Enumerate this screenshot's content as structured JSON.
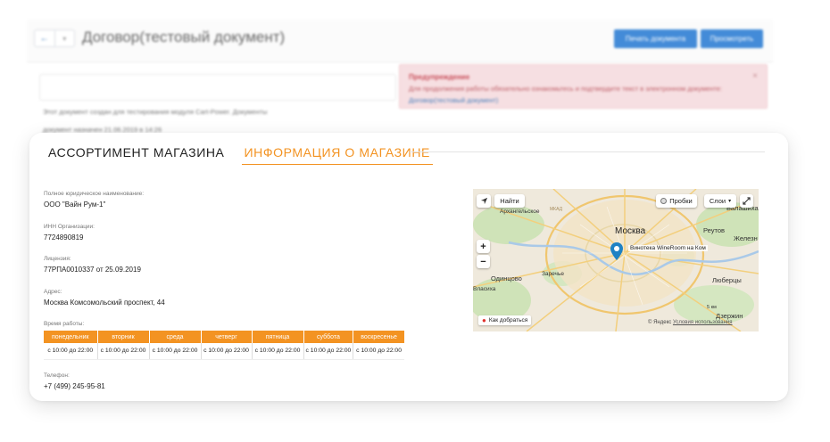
{
  "background": {
    "title": "Договор(тестовый документ)",
    "nav_back": "←",
    "nav_menu": "▾",
    "print_button": "Печать документа",
    "view_button": "Просмотреть",
    "warning": {
      "title": "Предупреждение",
      "text": "Для продолжения работы обязательно ознакомьтесь и подтвердите текст в электронном документе:",
      "link": "Договор(тестовый документ)",
      "close": "×"
    },
    "created_text": "Этот документ создан для тестирования модуля Cart-Power. Документы",
    "signed_text": "документ назначен 21.06.2019 в 14:26"
  },
  "tabs": {
    "assortment": "АССОРТИМЕНТ МАГАЗИНА",
    "info": "ИНФОРМАЦИЯ О МАГАЗИНЕ"
  },
  "store": {
    "legal_name_label": "Полное юридическое наименование:",
    "legal_name": "ООО \"Вайн Рум-1\"",
    "inn_label": "ИНН Организации:",
    "inn": "7724890819",
    "license_label": "Лицензия:",
    "license": "77РПА0010337 от 25.09.2019",
    "address_label": "Адрес:",
    "address": "Москва Комсомольский проспект, 44",
    "hours_label": "Время работы:",
    "days": [
      "понедельник",
      "вторник",
      "среда",
      "четверг",
      "пятница",
      "суббота",
      "воскресенье"
    ],
    "hours": [
      "с 10:00 до 22:00",
      "с 10:00 до 22:00",
      "с 10:00 до 22:00",
      "с 10:00 до 22:00",
      "с 10:00 до 22:00",
      "с 10:00 до 22:00",
      "с 10:00 до 22:00"
    ],
    "phone_label": "Телефон:",
    "phone": "+7 (499) 245-95-81"
  },
  "map": {
    "find_button": "Найти",
    "traffic_button": "Пробки",
    "layers_button": "Слои",
    "zoom_in": "+",
    "zoom_out": "−",
    "pin_label": "Винотека WineRoom на Ком",
    "route_button": "Как добраться",
    "copyright": "© Яндекс",
    "terms": "Условия использования",
    "scale": "5 км",
    "labels": {
      "moscow": "Москва",
      "arkhangelskoe": "Архангельское",
      "balashikha": "Балашиха",
      "reutov": "Реутов",
      "zheleznodorozhny": "Железн",
      "odintsovo": "Одинцово",
      "zarechye": "Заречье",
      "vlasikha": "Власиха",
      "lyubertsy": "Люберцы",
      "dzerzhinsky": "Дзержин",
      "mkad": "МКАД"
    }
  },
  "colors": {
    "accent": "#f39322",
    "primary_button": "#2f7fd4",
    "warning_bg": "#f6dcdf"
  }
}
